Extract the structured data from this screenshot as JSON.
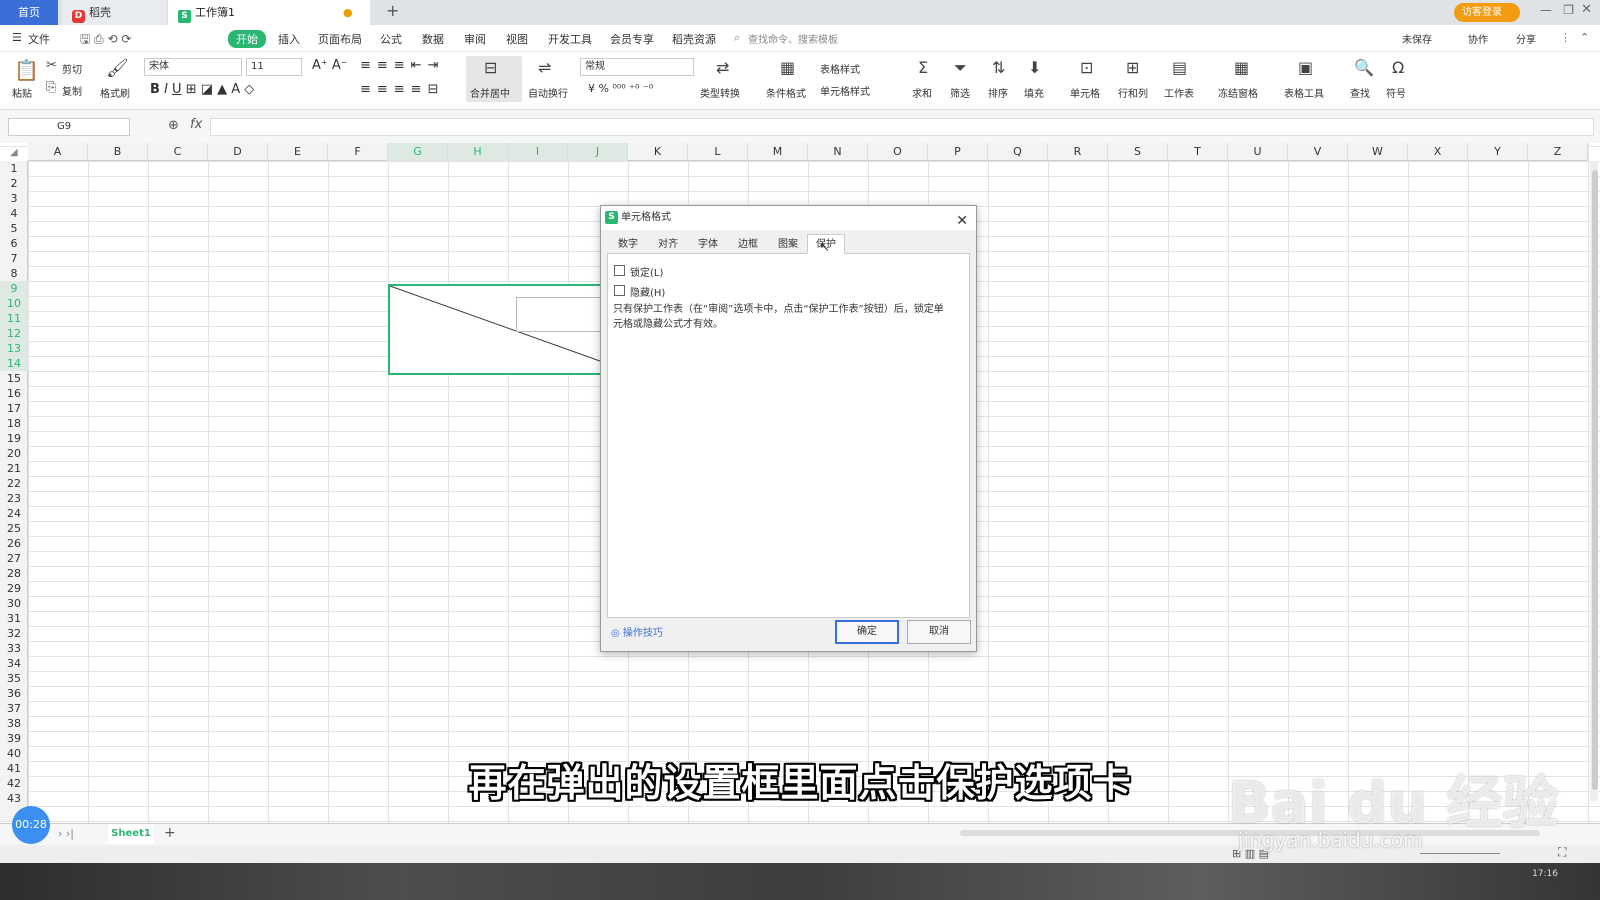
{
  "tabs": {
    "home": "首页",
    "daoke": "稻壳",
    "workbook": "工作簿1"
  },
  "login": "访客登录",
  "menu": {
    "file": "文件",
    "items": [
      "开始",
      "插入",
      "页面布局",
      "公式",
      "数据",
      "审阅",
      "视图",
      "开发工具",
      "会员专享",
      "稻壳资源"
    ],
    "search": "查找命令、搜索模板",
    "unsaved": "未保存",
    "collab": "协作",
    "share": "分享"
  },
  "toolbar": {
    "paste": "粘贴",
    "cut": "剪切",
    "copy": "复制",
    "format_painter": "格式刷",
    "font": "宋体",
    "size": "11",
    "merge": "合并居中",
    "wrap": "自动换行",
    "number_format": "常规",
    "type_convert": "类型转换",
    "cond_format": "条件格式",
    "table_style": "表格样式",
    "cell_style": "单元格样式",
    "sum": "求和",
    "filter": "筛选",
    "sort": "排序",
    "fill": "填充",
    "cell": "单元格",
    "row_col": "行和列",
    "worksheet": "工作表",
    "freeze": "冻结窗格",
    "table_tools": "表格工具",
    "find": "查找",
    "symbol": "符号"
  },
  "namebox": "G9",
  "columns": [
    "A",
    "B",
    "C",
    "D",
    "E",
    "F",
    "G",
    "H",
    "I",
    "J",
    "K",
    "L",
    "M",
    "N",
    "O",
    "P",
    "Q",
    "R",
    "S",
    "T",
    "U",
    "V",
    "W",
    "X",
    "Y",
    "Z"
  ],
  "rows": [
    "1",
    "2",
    "3",
    "4",
    "5",
    "6",
    "7",
    "8",
    "9",
    "10",
    "11",
    "12",
    "13",
    "14",
    "15",
    "16",
    "17",
    "18",
    "19",
    "20",
    "21",
    "22",
    "23",
    "24",
    "25",
    "26",
    "27",
    "28",
    "29",
    "30",
    "31",
    "32",
    "33",
    "34",
    "35",
    "36",
    "37",
    "38",
    "39",
    "40",
    "41",
    "42",
    "43"
  ],
  "dialog": {
    "title": "单元格格式",
    "tabs": [
      "数字",
      "对齐",
      "字体",
      "边框",
      "图案",
      "保护"
    ],
    "active_tab": "保护",
    "lock_label": "锁定(L)",
    "hide_label": "隐藏(H)",
    "note": "只有保护工作表（在“审阅”选项卡中，点击“保护工作表”按钮）后，锁定单元格或隐藏公式才有效。",
    "tips": "操作技巧",
    "ok": "确定",
    "cancel": "取消"
  },
  "subtitle": "再在弹出的设置框里面点击保护选项卡",
  "watermark": "Bai du 经验",
  "watermark_url": "jingyan.baidu.com",
  "sheet": "Sheet1",
  "timer": "00:28",
  "clock": "17:16",
  "colors": {
    "accent": "#2bb673",
    "blue": "#3b6fd8"
  }
}
